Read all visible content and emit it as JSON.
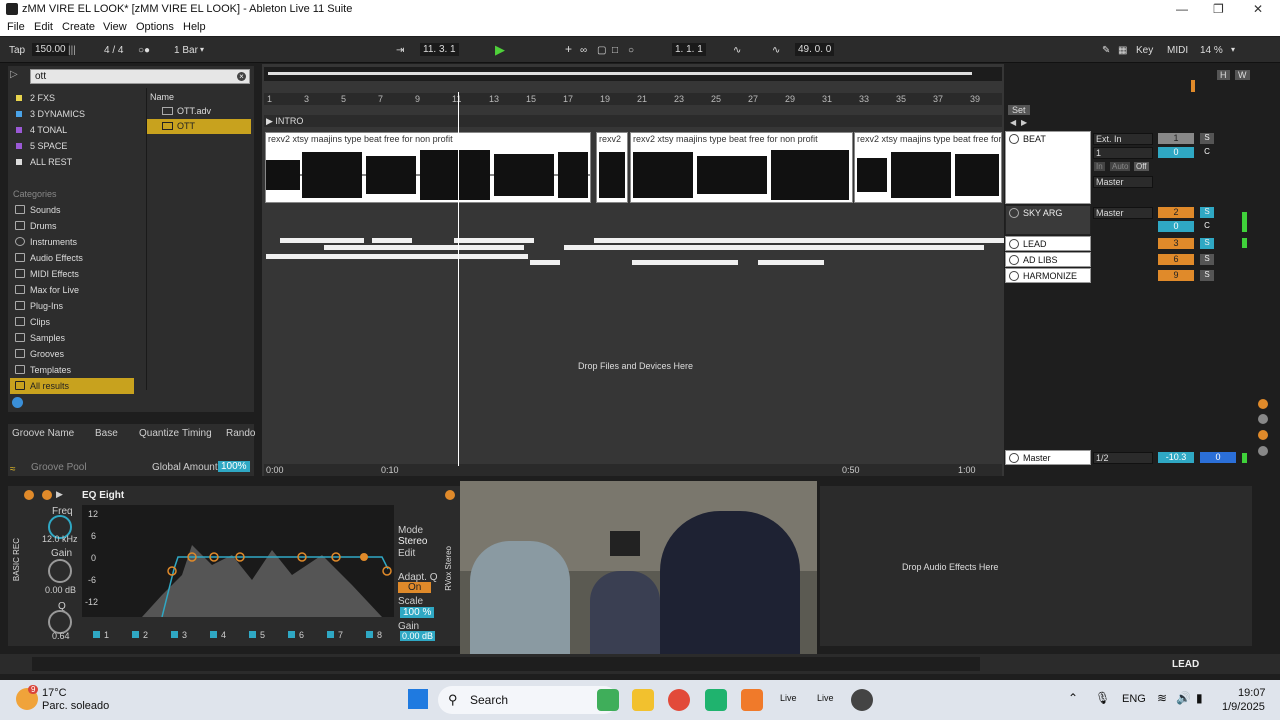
{
  "window": {
    "title": "zMM VIRE EL LOOK* [zMM VIRE EL LOOK] - Ableton Live 11 Suite"
  },
  "menu": [
    "File",
    "Edit",
    "Create",
    "View",
    "Options",
    "Help"
  ],
  "control_bar": {
    "tap": "Tap",
    "tempo": "150.00",
    "signature": "4 / 4",
    "quantize": "1 Bar",
    "position": "11.  3.  1",
    "loop_start": "1.  1.  1",
    "loop_length": "49.  0.  0",
    "key": "Key",
    "midi": "MIDI",
    "cpu": "14 %"
  },
  "browser": {
    "search_value": "ott",
    "collections": [
      {
        "label": "2 FXS",
        "color": "#e8d44d"
      },
      {
        "label": "3 DYNAMICS",
        "color": "#4aa3e8"
      },
      {
        "label": "4 TONAL",
        "color": "#9b59d6"
      },
      {
        "label": "5 SPACE",
        "color": "#9b59d6"
      },
      {
        "label": "ALL REST",
        "color": "#ddd"
      }
    ],
    "categories_title": "Categories",
    "categories": [
      "Sounds",
      "Drums",
      "Instruments",
      "Audio Effects",
      "MIDI Effects",
      "Max for Live",
      "Plug-Ins",
      "Clips",
      "Samples",
      "Grooves",
      "Templates",
      "All results"
    ],
    "name_header": "Name",
    "results": [
      "OTT.adv",
      "OTT"
    ]
  },
  "groove_pool": {
    "headers": [
      "Groove Name",
      "Base",
      "Quantize",
      "Timing",
      "Rando"
    ],
    "label": "Groove Pool",
    "global_amount_label": "Global Amount",
    "global_amount": "100%"
  },
  "arrangement": {
    "bars": [
      "1",
      "3",
      "5",
      "7",
      "9",
      "11",
      "13",
      "15",
      "17",
      "19",
      "21",
      "23",
      "25",
      "27",
      "29",
      "31",
      "33",
      "35",
      "37",
      "39"
    ],
    "locator": "INTRO",
    "clip_names": [
      "rexv2 xtsy  maajins type beat free for non profit",
      "rexv2",
      "rexv2 xtsy  maajins type beat free for non profit",
      "rexv2 xtsy  maajins type beat free for non fo"
    ],
    "drop_text": "Drop Files and Devices Here",
    "time_labels": [
      "0:00",
      "0:10",
      "0:50",
      "1:00"
    ],
    "set_label": "Set"
  },
  "tracks": [
    {
      "name": "BEAT",
      "input": "Ext. In",
      "input_ch": "1",
      "output": "Master",
      "vol": "1",
      "pan": "0"
    },
    {
      "name": "SKY ARG",
      "output": "Master",
      "vol": "2",
      "pan": "0"
    },
    {
      "name": "LEAD",
      "vol": "3"
    },
    {
      "name": "AD LIBS",
      "vol": "6"
    },
    {
      "name": "HARMONIZE",
      "vol": "9"
    }
  ],
  "monitor": [
    "In",
    "Auto",
    "Off"
  ],
  "pan_c": "C",
  "solo": "S",
  "master": {
    "name": "Master",
    "output": "1/2",
    "vol": "-10.3",
    "pan": "0"
  },
  "device": {
    "name": "EQ Eight",
    "chain_name": "BASIC REC",
    "freq_label": "Freq",
    "freq": "12.0 kHz",
    "gain_label": "Gain",
    "gain": "0.00 dB",
    "q_label": "Q",
    "q": "0.64",
    "db_scale": [
      "12",
      "6",
      "0",
      "-6",
      "-12"
    ],
    "freq_scale": [
      "100",
      "1k",
      "10k"
    ],
    "bands": [
      "1",
      "2",
      "3",
      "4",
      "5",
      "6",
      "7",
      "8"
    ],
    "mode_label": "Mode",
    "mode": "Stereo",
    "edit_label": "Edit",
    "adapt_label": "Adapt. Q",
    "adapt_value": "On",
    "scale_label": "Scale",
    "scale": "100 %",
    "out_gain_label": "Gain",
    "out_gain": "0.00 dB",
    "rvox": "RVox Stereo"
  },
  "drop_audio": "Drop Audio Effects Here",
  "status_track": "LEAD",
  "taskbar": {
    "temp": "17°C",
    "weather": "Parc. soleado",
    "search": "Search",
    "lang": "ENG",
    "time": "19:07",
    "date": "1/9/2025",
    "badge": "9",
    "live1": "Live",
    "live2": "Live"
  }
}
